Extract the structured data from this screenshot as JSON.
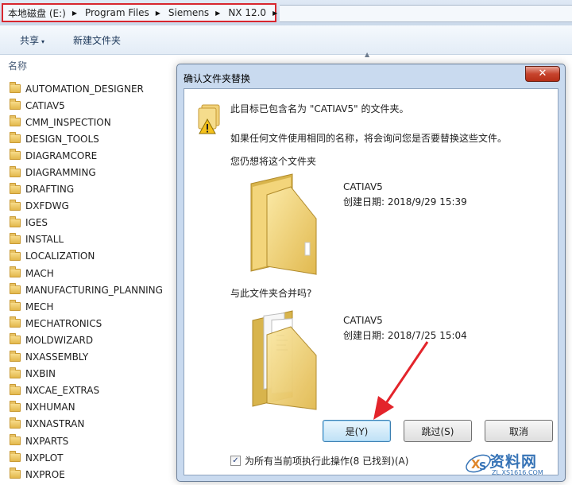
{
  "address_bar": {
    "crumbs": [
      "本地磁盘 (E:)",
      "Program Files",
      "Siemens",
      "NX 12.0"
    ],
    "separator_glyph": "▶",
    "highlight_color": "#d8262e"
  },
  "toolbar": {
    "share_label": "共享",
    "share_dropdown_glyph": "▾",
    "new_folder_label": "新建文件夹"
  },
  "file_list": {
    "column_header": "名称",
    "sort_glyph": "▲",
    "items": [
      "AUTOMATION_DESIGNER",
      "CATIAV5",
      "CMM_INSPECTION",
      "DESIGN_TOOLS",
      "DIAGRAMCORE",
      "DIAGRAMMING",
      "DRAFTING",
      "DXFDWG",
      "IGES",
      "INSTALL",
      "LOCALIZATION",
      "MACH",
      "MANUFACTURING_PLANNING",
      "MECH",
      "MECHATRONICS",
      "MOLDWIZARD",
      "NXASSEMBLY",
      "NXBIN",
      "NXCAE_EXTRAS",
      "NXHUMAN",
      "NXNASTRAN",
      "NXPARTS",
      "NXPLOT",
      "NXPROE"
    ]
  },
  "dialog": {
    "title": "确认文件夹替换",
    "close_glyph": "✕",
    "message_contains": "此目标已包含名为 \"CATIAV5\" 的文件夹。",
    "message_explain": "如果任何文件使用相同的名称，将会询问您是否要替换这些文件。",
    "message_question": "您仍想将这个文件夹",
    "message_merge": "与此文件夹合并吗?",
    "source_folder": {
      "name": "CATIAV5",
      "date": "创建日期: 2018/9/29 15:39"
    },
    "target_folder": {
      "name": "CATIAV5",
      "date": "创建日期: 2018/7/25 15:04"
    },
    "buttons": {
      "yes": "是(Y)",
      "skip": "跳过(S)",
      "cancel": "取消"
    },
    "apply_all": {
      "checked": true,
      "check_glyph": "✓",
      "label": "为所有当前项执行此操作(8 已找到)(A)"
    },
    "arrow_color": "#e3242b"
  },
  "watermark": {
    "text": "资料网",
    "url": "ZL.XS1616.COM",
    "color": "#3673b6"
  }
}
